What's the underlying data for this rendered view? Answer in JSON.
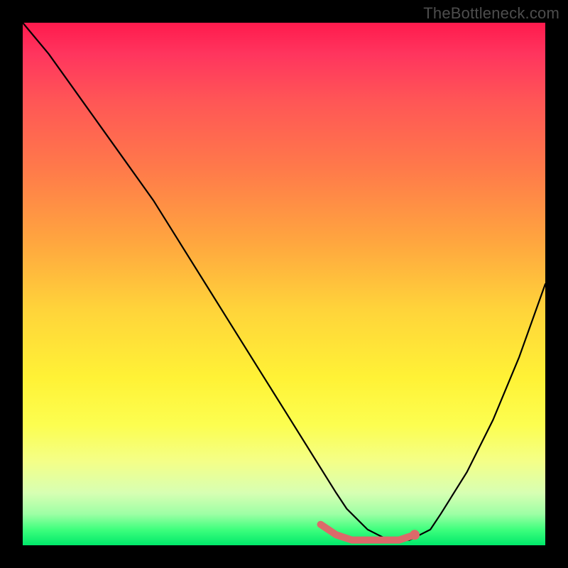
{
  "watermark": "TheBottleneck.com",
  "chart_data": {
    "type": "line",
    "title": "",
    "xlabel": "",
    "ylabel": "",
    "xlim": [
      0,
      100
    ],
    "ylim": [
      0,
      100
    ],
    "series": [
      {
        "name": "bottleneck-curve",
        "x": [
          0,
          5,
          10,
          15,
          20,
          25,
          30,
          35,
          40,
          45,
          50,
          55,
          60,
          62,
          64,
          66,
          68,
          70,
          72,
          74,
          76,
          78,
          80,
          85,
          90,
          95,
          100
        ],
        "values": [
          100,
          94,
          87,
          80,
          73,
          66,
          58,
          50,
          42,
          34,
          26,
          18,
          10,
          7,
          5,
          3,
          2,
          1,
          1,
          1,
          2,
          3,
          6,
          14,
          24,
          36,
          50
        ]
      }
    ],
    "highlight": {
      "name": "optimal-zone",
      "x": [
        57,
        60,
        63,
        66,
        69,
        72,
        75
      ],
      "values": [
        4,
        2,
        1,
        1,
        1,
        1,
        2
      ],
      "color": "#dc6a6a"
    },
    "highlight_end": {
      "x": 75,
      "y": 2
    },
    "colors": {
      "curve": "#000000",
      "highlight": "#dc6a6a",
      "gradient_top": "#ff1a4d",
      "gradient_bottom": "#00e86a"
    }
  }
}
